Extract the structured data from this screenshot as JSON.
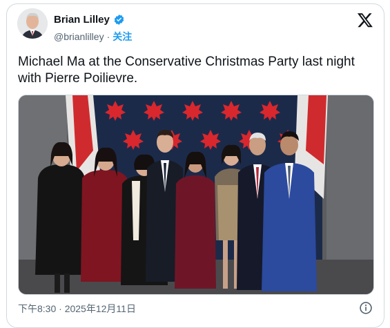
{
  "tweet": {
    "author_name": "Brian Lilley",
    "author_handle": "@brianlilley",
    "separator": "·",
    "follow_label": "关注",
    "text": "Michael Ma at the Conservative Christmas Party last night with Pierre Poilievre.",
    "timestamp": "下午8:30 · 2025年12月11日",
    "verified": true
  },
  "icons": {
    "verified": "verified-badge-icon",
    "platform": "x-logo-icon",
    "info": "info-icon"
  },
  "colors": {
    "accent": "#1d9bf0",
    "text_primary": "#0f1419",
    "text_secondary": "#536471",
    "backdrop_navy": "#1c2a4a",
    "maple_red": "#d9272e"
  }
}
